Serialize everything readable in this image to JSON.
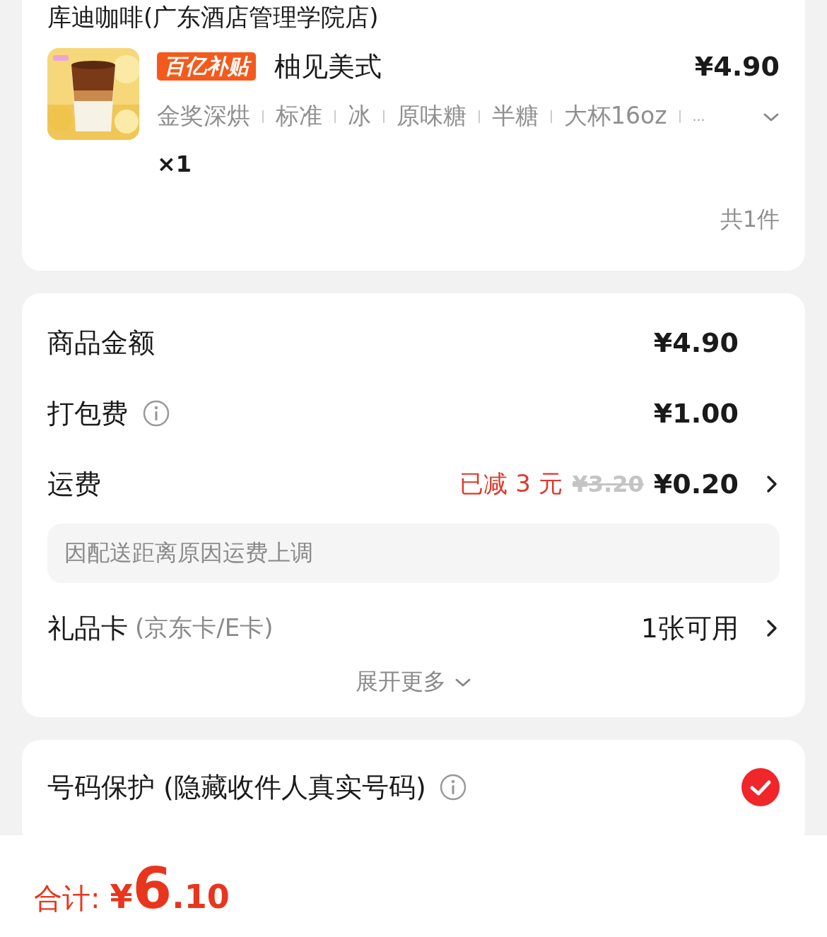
{
  "store_name": "库迪咖啡(广东酒店管理学院店)",
  "item": {
    "badge": "百亿补贴",
    "name": "柚见美式",
    "price": "¥4.90",
    "specs": [
      "金奖深烘",
      "标准",
      "冰",
      "原味糖",
      "半糖",
      "大杯16oz"
    ],
    "more": "…",
    "quantity": "×1"
  },
  "item_count": "共1件",
  "fees": [
    {
      "kind": "plain",
      "label": "商品金额",
      "value": "¥4.90"
    },
    {
      "kind": "info",
      "label": "打包费",
      "value": "¥1.00"
    },
    {
      "kind": "discount",
      "label": "运费",
      "discount": "已减 3 元",
      "original": "¥3.20",
      "value": "¥0.20"
    }
  ],
  "note": "因配送距离原因运费上调",
  "gift_card": {
    "label": "礼品卡",
    "sub": "(京东卡/E卡)",
    "value": "1张可用"
  },
  "expand": "展开更多",
  "number_protection": {
    "label": "号码保护 (隐藏收件人真实号码)",
    "checked": true
  },
  "total": {
    "label": "合计:",
    "currency": "¥",
    "integer": "6",
    "decimal": ".10"
  }
}
